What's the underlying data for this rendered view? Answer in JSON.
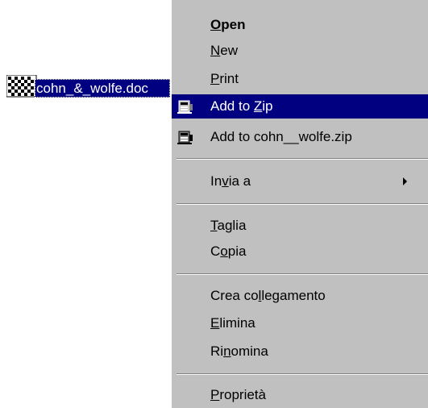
{
  "desktop": {
    "file_label": "cohn_&_wolfe.doc"
  },
  "context_menu": {
    "items": [
      {
        "id": "open",
        "before": "",
        "mnemonic": "O",
        "after": "pen"
      },
      {
        "id": "new",
        "before": "",
        "mnemonic": "N",
        "after": "ew"
      },
      {
        "id": "print",
        "before": "",
        "mnemonic": "P",
        "after": "rint"
      },
      {
        "id": "add-to-zip",
        "before": "Add to ",
        "mnemonic": "Z",
        "after": "ip"
      },
      {
        "id": "add-to-named-zip",
        "before": "Add to cohn__wolfe.zip",
        "mnemonic": "",
        "after": ""
      },
      {
        "id": "send-to",
        "before": "In",
        "mnemonic": "v",
        "after": "ia a"
      },
      {
        "id": "cut",
        "before": "",
        "mnemonic": "T",
        "after": "aglia"
      },
      {
        "id": "copy",
        "before": "C",
        "mnemonic": "o",
        "after": "pia"
      },
      {
        "id": "create-shortcut",
        "before": "Crea co",
        "mnemonic": "l",
        "after": "legamento"
      },
      {
        "id": "delete",
        "before": "",
        "mnemonic": "E",
        "after": "limina"
      },
      {
        "id": "rename",
        "before": "Ri",
        "mnemonic": "n",
        "after": "omina"
      },
      {
        "id": "properties",
        "before": "",
        "mnemonic": "P",
        "after": "roprietà"
      }
    ]
  },
  "colors": {
    "menu_background": "#c0c0c0",
    "highlight": "#000080",
    "highlight_text": "#ffffff",
    "separator_dark": "#808080"
  },
  "icons": {
    "file": "document-icon",
    "zip": "winzip-icon"
  }
}
